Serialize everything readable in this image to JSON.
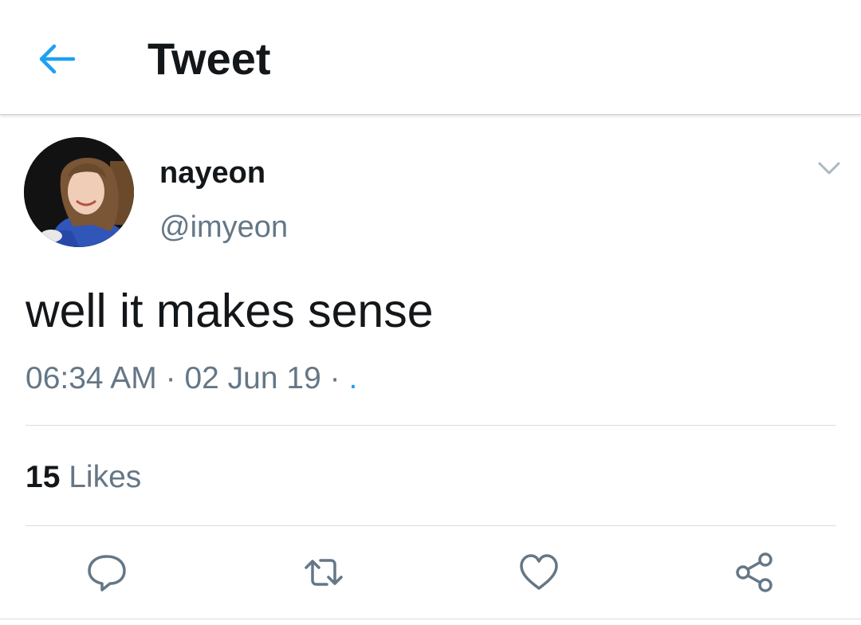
{
  "header": {
    "title": "Tweet",
    "back_icon": "arrow-left-icon",
    "accent_color": "#1da1f2"
  },
  "tweet": {
    "author": {
      "display_name": "nayeon",
      "handle": "@imyeon"
    },
    "text": "well it makes sense",
    "time": "06:34 AM",
    "sep1": "·",
    "date": "02 Jun 19",
    "sep2": "·",
    "source": ".",
    "likes": {
      "count": "15",
      "label": "Likes"
    }
  },
  "actions": {
    "reply_icon": "reply-icon",
    "retweet_icon": "retweet-icon",
    "like_icon": "heart-icon",
    "share_icon": "share-icon"
  },
  "colors": {
    "text_primary": "#14171a",
    "text_secondary": "#657786",
    "divider": "#d6dde3"
  }
}
